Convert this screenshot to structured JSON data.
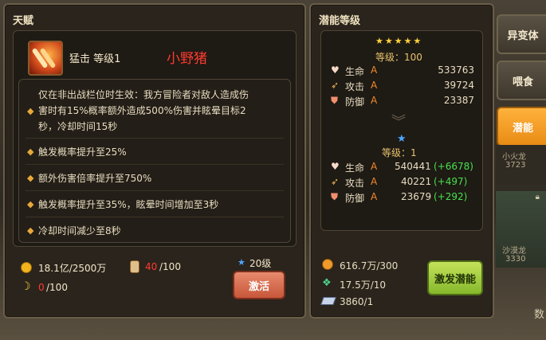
{
  "talent": {
    "title": "天赋",
    "skill_name": "猛击 等级1",
    "pet_name": "小野猪",
    "description": "仅在非出战栏位时生效：我方冒险者对敌人造成伤害时有15%概率额外造成500%伤害并眩晕目标2秒，冷却时间15秒",
    "desc_lines": [
      "仅在非出战栏位时生效：我方冒险者对敌人造成伤",
      "害时有15%概率额外造成500%伤害并眩晕目标2",
      "秒，冷却时间15秒"
    ],
    "upgrades": [
      "触发概率提升至25%",
      "额外伤害倍率提升至750%",
      "触发概率提升至35%，眩晕时间增加至3秒",
      "冷却时间减少至8秒"
    ],
    "gold": "18.1亿/2500万",
    "bottle_current": "40",
    "bottle_total": "/100",
    "banana_current": "0",
    "banana_total": "/100",
    "star_level": "20级",
    "activate_label": "激活"
  },
  "potential": {
    "title": "潜能等级",
    "current_stars": "★★★★★",
    "current_level": "等级：100",
    "current_stats": [
      {
        "icon": "heart-icon",
        "label": "生命",
        "grade": "A",
        "value": "533763"
      },
      {
        "icon": "sword-icon",
        "label": "攻击",
        "grade": "A",
        "value": "39724"
      },
      {
        "icon": "shield-icon",
        "label": "防御",
        "grade": "A",
        "value": "23387"
      }
    ],
    "next_star": "★",
    "next_level": "等级：1",
    "next_stats": [
      {
        "icon": "heart-icon",
        "label": "生命",
        "grade": "A",
        "value": "540441",
        "delta": "(+6678)"
      },
      {
        "icon": "sword-icon",
        "label": "攻击",
        "grade": "A",
        "value": "40221",
        "delta": "(+497)"
      },
      {
        "icon": "shield-icon",
        "label": "防御",
        "grade": "A",
        "value": "23679",
        "delta": "(+292)"
      }
    ],
    "cost_1": "616.7万/300",
    "cost_2": "17.5万/10",
    "cost_3": "3860/1",
    "button_label": "激发潜能"
  },
  "side": {
    "tabs": [
      "异变体",
      "喂食",
      "潜能"
    ],
    "card_1_name": "小火龙",
    "card_1_value": "3723",
    "card_2_name": "沙漠龙",
    "card_2_value": "3330",
    "partial_label": "数"
  },
  "colors": {
    "accent_orange": "#e88b14",
    "grade_orange": "#f08a2c",
    "red_text": "#ff3b2f",
    "green_delta": "#47e04d"
  }
}
